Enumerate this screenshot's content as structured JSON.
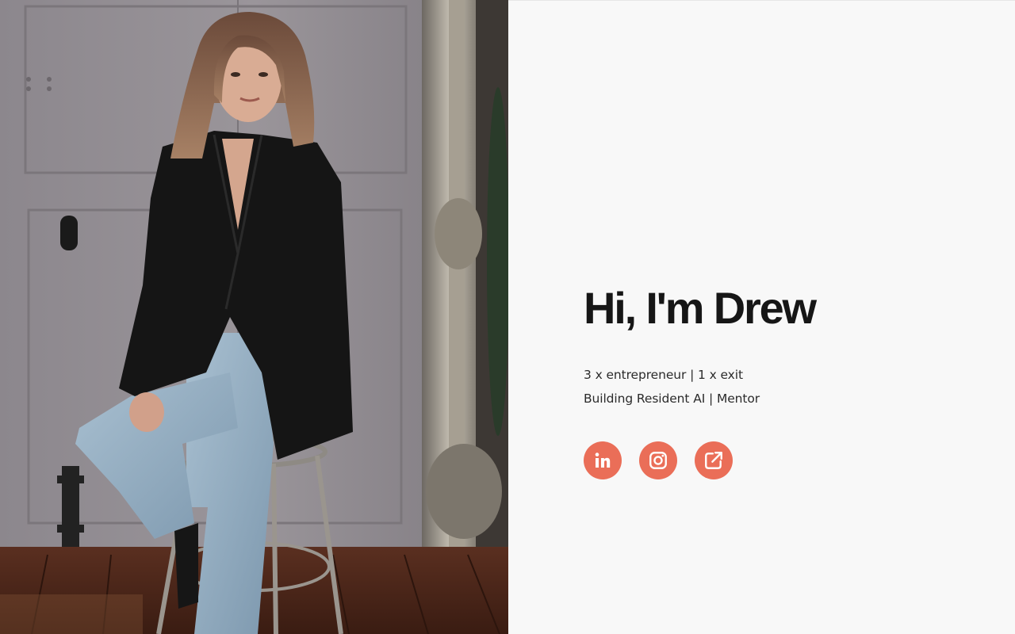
{
  "hero": {
    "title": "Hi, I'm Drew",
    "tagline_line1": "3 x entrepreneur | 1 x exit",
    "tagline_line2": "Building Resident AI | Mentor"
  },
  "photo": {
    "alt": "Portrait of Drew seated on a bar stool"
  },
  "socials": [
    {
      "name": "LinkedIn",
      "icon": "linkedin-icon"
    },
    {
      "name": "Instagram",
      "icon": "instagram-icon"
    },
    {
      "name": "Website",
      "icon": "external-link-icon"
    }
  ],
  "colors": {
    "accent": "#ea6e58",
    "background": "#f8f8f8",
    "text": "#161616"
  }
}
